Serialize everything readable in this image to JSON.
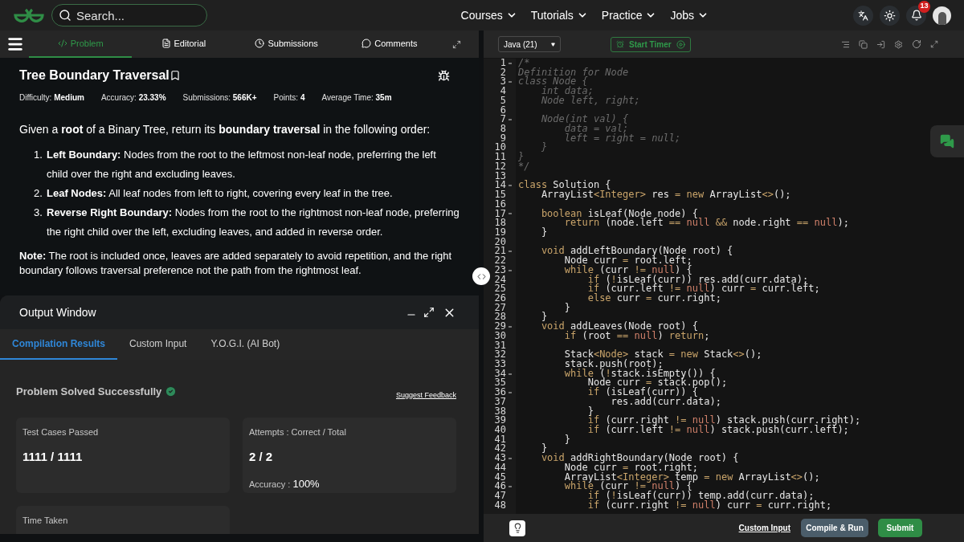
{
  "nav": {
    "search_placeholder": "Search...",
    "menus": [
      "Courses",
      "Tutorials",
      "Practice",
      "Jobs"
    ],
    "notification_count": "13"
  },
  "problem_tabs": [
    {
      "label": "Problem",
      "kind": "code",
      "selected": true
    },
    {
      "label": "Editorial",
      "kind": "doc",
      "selected": false
    },
    {
      "label": "Submissions",
      "kind": "clock",
      "selected": false
    },
    {
      "label": "Comments",
      "kind": "chat",
      "selected": false
    }
  ],
  "problem": {
    "title": "Tree Boundary Traversal",
    "stats": [
      {
        "label": "Difficulty:",
        "value": "Medium"
      },
      {
        "label": "Accuracy:",
        "value": "23.33%"
      },
      {
        "label": "Submissions:",
        "value": "566K+"
      },
      {
        "label": "Points:",
        "value": "4"
      },
      {
        "label": "Average Time:",
        "value": "35m"
      }
    ],
    "intro": "Given a **root** of a Binary Tree, return its **boundary traversal** in the following order:",
    "steps": [
      {
        "number": "1.",
        "text": "**Left Boundary:** Nodes from the root to the leftmost non-leaf node, preferring the left child over the right and excluding leaves."
      },
      {
        "number": "2.",
        "text": "**Leaf Nodes:** All leaf nodes from left to right, covering every leaf in the tree."
      },
      {
        "number": "3.",
        "text": "**Reverse Right Boundary:** Nodes from the root to the rightmost non-leaf node, preferring the right child over the left, excluding leaves, and added in reverse order."
      }
    ],
    "note": "**Note:** The root is included once, leaves are added separately to avoid repetition, and the right boundary follows traversal preference not the path from the rightmost leaf."
  },
  "output_window": {
    "title": "Output Window",
    "tabs": [
      {
        "label": "Compilation Results",
        "selected": true
      },
      {
        "label": "Custom Input",
        "selected": false
      },
      {
        "label": "Y.O.G.I. (AI Bot)",
        "selected": false
      }
    ],
    "status": "Problem Solved Successfully",
    "feedback_link": "Suggest Feedback",
    "cards": [
      {
        "label": "Test Cases Passed",
        "value": "1111 / 1111"
      },
      {
        "label": "Attempts : Correct / Total",
        "value": "2 / 2",
        "extra_label": "Accuracy :",
        "extra_value": "100%"
      },
      {
        "label": "Time Taken"
      }
    ]
  },
  "editor": {
    "language": "Java (21)",
    "timer_button": "Start Timer",
    "lines": [
      {
        "n": "1",
        "fold": true,
        "segs": [
          {
            "kind": "cm",
            "text": "/*"
          }
        ]
      },
      {
        "n": "2",
        "fold": false,
        "segs": [
          {
            "kind": "cm",
            "text": "Definition for Node"
          }
        ]
      },
      {
        "n": "3",
        "fold": true,
        "segs": [
          {
            "kind": "cm",
            "text": "class Node {"
          }
        ]
      },
      {
        "n": "4",
        "fold": false,
        "segs": [
          {
            "kind": "cm",
            "text": "    int data;"
          }
        ]
      },
      {
        "n": "5",
        "fold": false,
        "segs": [
          {
            "kind": "cm",
            "text": "    Node left, right;"
          }
        ]
      },
      {
        "n": "6",
        "fold": false
      },
      {
        "n": "7",
        "fold": true,
        "segs": [
          {
            "kind": "cm",
            "text": "    Node(int val) {"
          }
        ]
      },
      {
        "n": "8",
        "fold": false,
        "segs": [
          {
            "kind": "cm",
            "text": "        data = val;"
          }
        ]
      },
      {
        "n": "9",
        "fold": false,
        "segs": [
          {
            "kind": "cm",
            "text": "        left = right = null;"
          }
        ]
      },
      {
        "n": "10",
        "fold": false,
        "segs": [
          {
            "kind": "cm",
            "text": "    }"
          }
        ]
      },
      {
        "n": "11",
        "fold": false,
        "segs": [
          {
            "kind": "cm",
            "text": "}"
          }
        ]
      },
      {
        "n": "12",
        "fold": false,
        "segs": [
          {
            "kind": "cm",
            "text": "*/"
          }
        ]
      },
      {
        "n": "13",
        "fold": false
      },
      {
        "n": "14",
        "fold": true,
        "segs": [
          {
            "kind": "kw",
            "text": "class"
          },
          {
            "kind": "id",
            "text": " Solution {"
          }
        ]
      },
      {
        "n": "15",
        "fold": false,
        "segs": [
          {
            "kind": "id",
            "text": "    ArrayList"
          },
          {
            "kind": "kw",
            "text": "<Integer>"
          },
          {
            "kind": "id",
            "text": " res "
          },
          {
            "kind": "kw",
            "text": "="
          },
          {
            "kind": "kw",
            "text": " new"
          },
          {
            "kind": "id",
            "text": " ArrayList"
          },
          {
            "kind": "kw",
            "text": "<>"
          },
          {
            "kind": "id",
            "text": "();"
          }
        ]
      },
      {
        "n": "16",
        "fold": false
      },
      {
        "n": "17",
        "fold": true,
        "segs": [
          {
            "kind": "kw",
            "text": "    boolean"
          },
          {
            "kind": "id",
            "text": " isLeaf(Node node) {"
          }
        ]
      },
      {
        "n": "18",
        "fold": false,
        "segs": [
          {
            "kind": "kw",
            "text": "        return"
          },
          {
            "kind": "id",
            "text": " (node.left "
          },
          {
            "kind": "kw",
            "text": "=="
          },
          {
            "kind": "nl",
            "text": " null"
          },
          {
            "kind": "kw",
            "text": " &&"
          },
          {
            "kind": "id",
            "text": " node.right "
          },
          {
            "kind": "kw",
            "text": "=="
          },
          {
            "kind": "nl",
            "text": " null"
          },
          {
            "kind": "id",
            "text": ");"
          }
        ]
      },
      {
        "n": "19",
        "fold": false,
        "segs": [
          {
            "kind": "id",
            "text": "    }"
          }
        ]
      },
      {
        "n": "20",
        "fold": false
      },
      {
        "n": "21",
        "fold": true,
        "segs": [
          {
            "kind": "kw",
            "text": "    void"
          },
          {
            "kind": "id",
            "text": " addLeftBoundary(Node root) {"
          }
        ]
      },
      {
        "n": "22",
        "fold": false,
        "segs": [
          {
            "kind": "id",
            "text": "        Node curr "
          },
          {
            "kind": "kw",
            "text": "="
          },
          {
            "kind": "id",
            "text": " root.left;"
          }
        ]
      },
      {
        "n": "23",
        "fold": true,
        "segs": [
          {
            "kind": "kw",
            "text": "        while"
          },
          {
            "kind": "id",
            "text": " (curr "
          },
          {
            "kind": "kw",
            "text": "!="
          },
          {
            "kind": "nl",
            "text": " null"
          },
          {
            "kind": "id",
            "text": ") {"
          }
        ]
      },
      {
        "n": "24",
        "fold": false,
        "segs": [
          {
            "kind": "kw",
            "text": "            if"
          },
          {
            "kind": "id",
            "text": " ("
          },
          {
            "kind": "kw",
            "text": "!"
          },
          {
            "kind": "id",
            "text": "isLeaf(curr)) res.add(curr.data);"
          }
        ]
      },
      {
        "n": "25",
        "fold": false,
        "segs": [
          {
            "kind": "kw",
            "text": "            if"
          },
          {
            "kind": "id",
            "text": " (curr.left "
          },
          {
            "kind": "kw",
            "text": "!="
          },
          {
            "kind": "nl",
            "text": " null"
          },
          {
            "kind": "id",
            "text": ") curr "
          },
          {
            "kind": "kw",
            "text": "="
          },
          {
            "kind": "id",
            "text": " curr.left;"
          }
        ]
      },
      {
        "n": "26",
        "fold": false,
        "segs": [
          {
            "kind": "kw",
            "text": "            else"
          },
          {
            "kind": "id",
            "text": " curr "
          },
          {
            "kind": "kw",
            "text": "="
          },
          {
            "kind": "id",
            "text": " curr.right;"
          }
        ]
      },
      {
        "n": "27",
        "fold": false,
        "segs": [
          {
            "kind": "id",
            "text": "        }"
          }
        ]
      },
      {
        "n": "28",
        "fold": false,
        "segs": [
          {
            "kind": "id",
            "text": "    }"
          }
        ]
      },
      {
        "n": "29",
        "fold": true,
        "segs": [
          {
            "kind": "kw",
            "text": "    void"
          },
          {
            "kind": "id",
            "text": " addLeaves(Node root) {"
          }
        ]
      },
      {
        "n": "30",
        "fold": false,
        "segs": [
          {
            "kind": "kw",
            "text": "        if"
          },
          {
            "kind": "id",
            "text": " (root "
          },
          {
            "kind": "kw",
            "text": "=="
          },
          {
            "kind": "nl",
            "text": " null"
          },
          {
            "kind": "id",
            "text": ") "
          },
          {
            "kind": "kw",
            "text": "return"
          },
          {
            "kind": "id",
            "text": ";"
          }
        ]
      },
      {
        "n": "31",
        "fold": false
      },
      {
        "n": "32",
        "fold": false,
        "segs": [
          {
            "kind": "id",
            "text": "        Stack"
          },
          {
            "kind": "kw",
            "text": "<Node>"
          },
          {
            "kind": "id",
            "text": " stack "
          },
          {
            "kind": "kw",
            "text": "="
          },
          {
            "kind": "kw",
            "text": " new"
          },
          {
            "kind": "id",
            "text": " Stack"
          },
          {
            "kind": "kw",
            "text": "<>"
          },
          {
            "kind": "id",
            "text": "();"
          }
        ]
      },
      {
        "n": "33",
        "fold": false,
        "segs": [
          {
            "kind": "id",
            "text": "        stack.push(root);"
          }
        ]
      },
      {
        "n": "34",
        "fold": true,
        "segs": [
          {
            "kind": "kw",
            "text": "        while"
          },
          {
            "kind": "id",
            "text": " ("
          },
          {
            "kind": "kw",
            "text": "!"
          },
          {
            "kind": "id",
            "text": "stack.isEmpty()) {"
          }
        ]
      },
      {
        "n": "35",
        "fold": false,
        "segs": [
          {
            "kind": "id",
            "text": "            Node curr "
          },
          {
            "kind": "kw",
            "text": "="
          },
          {
            "kind": "id",
            "text": " stack.pop();"
          }
        ]
      },
      {
        "n": "36",
        "fold": true,
        "segs": [
          {
            "kind": "kw",
            "text": "            if"
          },
          {
            "kind": "id",
            "text": " (isLeaf(curr)) {"
          }
        ]
      },
      {
        "n": "37",
        "fold": false,
        "segs": [
          {
            "kind": "id",
            "text": "                res.add(curr.data);"
          }
        ]
      },
      {
        "n": "38",
        "fold": false,
        "segs": [
          {
            "kind": "id",
            "text": "            }"
          }
        ]
      },
      {
        "n": "39",
        "fold": false,
        "segs": [
          {
            "kind": "kw",
            "text": "            if"
          },
          {
            "kind": "id",
            "text": " (curr.right "
          },
          {
            "kind": "kw",
            "text": "!="
          },
          {
            "kind": "nl",
            "text": " null"
          },
          {
            "kind": "id",
            "text": ") stack.push(curr.right);"
          }
        ]
      },
      {
        "n": "40",
        "fold": false,
        "segs": [
          {
            "kind": "kw",
            "text": "            if"
          },
          {
            "kind": "id",
            "text": " (curr.left "
          },
          {
            "kind": "kw",
            "text": "!="
          },
          {
            "kind": "nl",
            "text": " null"
          },
          {
            "kind": "id",
            "text": ") stack.push(curr.left);"
          }
        ]
      },
      {
        "n": "41",
        "fold": false,
        "segs": [
          {
            "kind": "id",
            "text": "        }"
          }
        ]
      },
      {
        "n": "42",
        "fold": false,
        "segs": [
          {
            "kind": "id",
            "text": "    }"
          }
        ]
      },
      {
        "n": "43",
        "fold": true,
        "segs": [
          {
            "kind": "kw",
            "text": "    void"
          },
          {
            "kind": "id",
            "text": " addRightBoundary(Node root) {"
          }
        ]
      },
      {
        "n": "44",
        "fold": false,
        "segs": [
          {
            "kind": "id",
            "text": "        Node curr "
          },
          {
            "kind": "kw",
            "text": "="
          },
          {
            "kind": "id",
            "text": " root.right;"
          }
        ]
      },
      {
        "n": "45",
        "fold": false,
        "segs": [
          {
            "kind": "id",
            "text": "        ArrayList"
          },
          {
            "kind": "kw",
            "text": "<Integer>"
          },
          {
            "kind": "id",
            "text": " temp "
          },
          {
            "kind": "kw",
            "text": "="
          },
          {
            "kind": "kw",
            "text": " new"
          },
          {
            "kind": "id",
            "text": " ArrayList"
          },
          {
            "kind": "kw",
            "text": "<>"
          },
          {
            "kind": "id",
            "text": "();"
          }
        ]
      },
      {
        "n": "46",
        "fold": true,
        "segs": [
          {
            "kind": "kw",
            "text": "        while"
          },
          {
            "kind": "id",
            "text": " (curr "
          },
          {
            "kind": "kw",
            "text": "!="
          },
          {
            "kind": "nl",
            "text": " null"
          },
          {
            "kind": "id",
            "text": ") {"
          }
        ]
      },
      {
        "n": "47",
        "fold": false,
        "segs": [
          {
            "kind": "kw",
            "text": "            if"
          },
          {
            "kind": "id",
            "text": " ("
          },
          {
            "kind": "kw",
            "text": "!"
          },
          {
            "kind": "id",
            "text": "isLeaf(curr)) temp.add(curr.data);"
          }
        ]
      },
      {
        "n": "48",
        "fold": false,
        "segs": [
          {
            "kind": "kw",
            "text": "            if"
          },
          {
            "kind": "id",
            "text": " (curr.right "
          },
          {
            "kind": "kw",
            "text": "!="
          },
          {
            "kind": "nl",
            "text": " null"
          },
          {
            "kind": "id",
            "text": ") curr "
          },
          {
            "kind": "kw",
            "text": "="
          },
          {
            "kind": "id",
            "text": " curr.right;"
          }
        ]
      }
    ]
  },
  "footer": {
    "custom_input": "Custom Input",
    "compile": "Compile & Run",
    "submit": "Submit"
  }
}
